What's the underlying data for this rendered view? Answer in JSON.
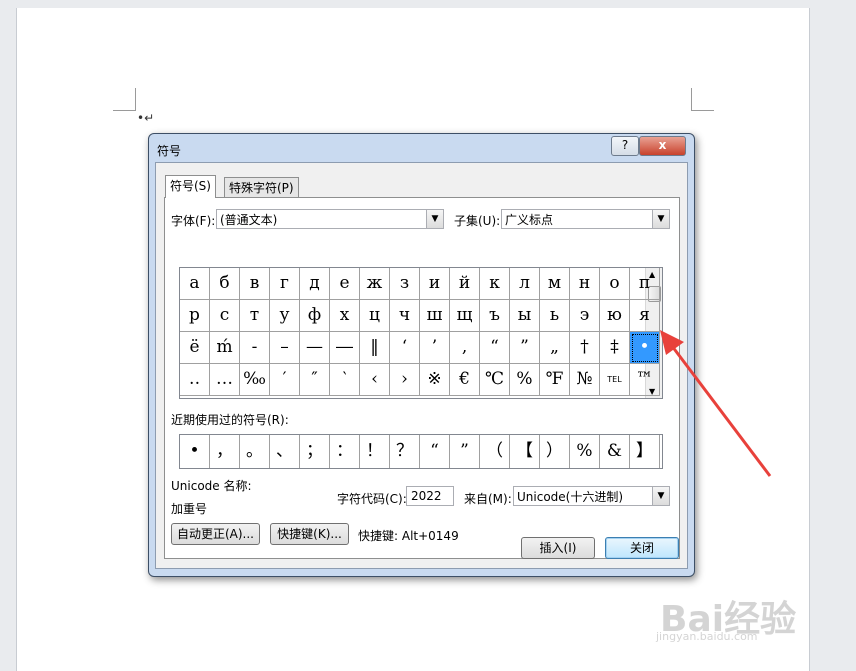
{
  "dialog": {
    "title": "符号",
    "help_label": "?",
    "close_label": "x",
    "tabs": [
      {
        "label": "符号(S)"
      },
      {
        "label": "特殊字符(P)"
      }
    ],
    "font_label": "字体(F):",
    "font_value": "(普通文本)",
    "subset_label": "子集(U):",
    "subset_value": "广义标点",
    "grid_rows": [
      [
        "а",
        "б",
        "в",
        "г",
        "д",
        "е",
        "ж",
        "з",
        "и",
        "й",
        "к",
        "л",
        "м",
        "н",
        "о",
        "п"
      ],
      [
        "р",
        "с",
        "т",
        "у",
        "ф",
        "х",
        "ц",
        "ч",
        "ш",
        "щ",
        "ъ",
        "ы",
        "ь",
        "э",
        "ю",
        "я"
      ],
      [
        "ё",
        "ḿ",
        "‐",
        "–",
        "—",
        "―",
        "‖",
        "‘",
        "’",
        "‚",
        "“",
        "”",
        "„",
        "†",
        "‡",
        "•"
      ],
      [
        "‥",
        "…",
        "‰",
        "′",
        "″",
        "‵",
        "‹",
        "›",
        "※",
        "€",
        "℃",
        "%",
        "℉",
        "№",
        "TEL",
        "™"
      ]
    ],
    "selected_symbol": "•",
    "recent_label": "近期使用过的符号(R):",
    "recent_symbols": [
      "•",
      "，",
      "。",
      "、",
      "；",
      "：",
      "！",
      "？",
      "“",
      "”",
      "（",
      "【",
      "）",
      "%",
      "&",
      "】"
    ],
    "unicode_name_label": "Unicode 名称:",
    "unicode_name_value": "加重号",
    "char_code_label": "字符代码(C):",
    "char_code_value": "2022",
    "from_label": "来自(M):",
    "from_value": "Unicode(十六进制)",
    "autocorrect_button": "自动更正(A)...",
    "shortcut_button": "快捷键(K)...",
    "shortcut_text": "快捷键: Alt+0149",
    "insert_button": "插入(I)",
    "close_button": "关闭"
  },
  "document": {
    "bullet_mark": "•↵"
  },
  "watermark": {
    "brand": "Bai经验",
    "url": "jingyan.baidu.com"
  },
  "colors": {
    "selection": "#3399ff",
    "arrow": "#e8413b"
  }
}
